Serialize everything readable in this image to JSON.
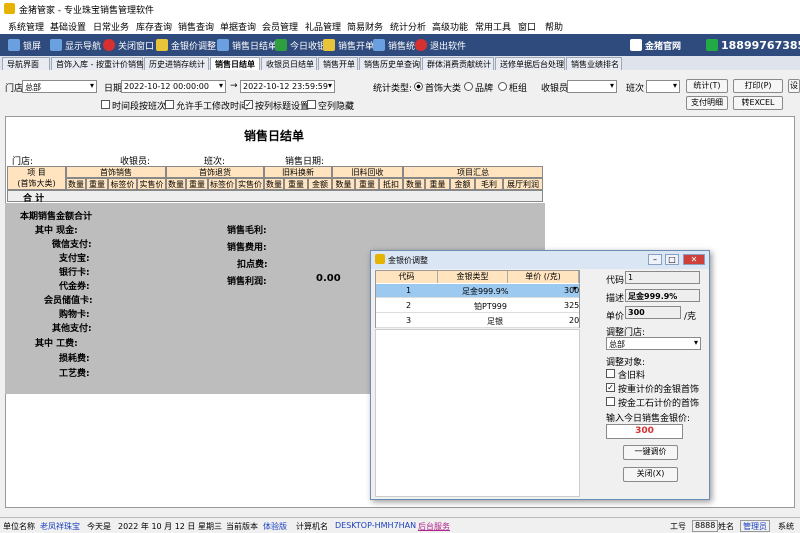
{
  "app": {
    "title": "金猪管家 - 专业珠宝销售管理软件"
  },
  "menu": [
    "系统管理",
    "基础设置",
    "日常业务",
    "库存查询",
    "销售查询",
    "单据查询",
    "会员管理",
    "礼品管理",
    "简易财务",
    "统计分析",
    "高级功能",
    "常用工具",
    "窗口",
    "帮助"
  ],
  "toolbar": {
    "items": [
      {
        "label": "锁屏",
        "icon": "lock-icon"
      },
      {
        "label": "显示导航",
        "icon": "navigation-icon"
      },
      {
        "label": "关闭窗口",
        "icon": "close-window-icon"
      },
      {
        "label": "金银价调整",
        "icon": "gold-price-icon"
      },
      {
        "label": "销售日结单",
        "icon": "daily-report-icon"
      },
      {
        "label": "今日收银",
        "icon": "cashier-icon"
      },
      {
        "label": "销售开单",
        "icon": "sales-order-icon"
      },
      {
        "label": "销售统计",
        "icon": "statistics-icon"
      },
      {
        "label": "退出软件",
        "icon": "exit-icon"
      }
    ],
    "website": "金猪官网",
    "phone": "18899767385"
  },
  "tabs": [
    "导航界面",
    "首饰入库 - 按重计价销售",
    "历史进销存统计",
    "销售日结单",
    "收银员日结单",
    "销售开单",
    "销售历史单查询",
    "群体消费贡献统计",
    "送修单据后台处理",
    "销售业绩排名"
  ],
  "active_tab": "销售日结单",
  "filters": {
    "store_label": "门店",
    "store_value": "总部",
    "date_label": "日期",
    "date_from": "2022-10-12 00:00:00",
    "date_to": "2022-10-12 23:59:59",
    "stat_type_label": "统计类型:",
    "stat_types": [
      "首饰大类",
      "品牌",
      "柜组"
    ],
    "cashier_label": "收银员",
    "shift_label": "班次",
    "options": [
      "时间段按班次",
      "允许手工修改时间",
      "按列标题设置",
      "空列隐藏"
    ],
    "buttons": {
      "stats": "统计(T)",
      "print": "打印(P)",
      "settings": "设",
      "payment_detail": "支付明细",
      "to_excel": "转EXCEL"
    }
  },
  "report": {
    "title": "销售日结单",
    "meta": [
      "门店:",
      "收银员:",
      "班次:",
      "销售日期:"
    ],
    "group_headers": [
      "项  目",
      "首饰销售",
      "首饰退货",
      "旧料换新",
      "旧料回收",
      "项目汇总"
    ],
    "item_sub": "(首饰大类)",
    "sub_headers": [
      "数量",
      "重量",
      "标签价",
      "实售价",
      "数量",
      "重量",
      "标签价",
      "实售价",
      "数量",
      "重量",
      "金额",
      "数量",
      "重量",
      "抵扣",
      "数量",
      "重量",
      "金额",
      "毛利",
      "展厅利润"
    ],
    "total_label": "合  计",
    "section_title": "本期销售金额合计",
    "left_labels": [
      "其中    现金:",
      "微信支付:",
      "支付宝:",
      "银行卡:",
      "代金券:",
      "会员储值卡:",
      "购物卡:",
      "其他支付:",
      "其中    工费:",
      "损耗费:",
      "工艺费:"
    ],
    "right_labels": [
      "销售毛利:",
      "销售费用:",
      "扣点费:",
      "销售利润:"
    ],
    "profit_value": "0.00"
  },
  "dialog": {
    "title": "金银价调整",
    "columns": [
      "代码",
      "金银类型",
      "单价 (/克)"
    ],
    "rows": [
      {
        "code": "1",
        "type": "足金999.9%",
        "price": "300"
      },
      {
        "code": "2",
        "type": "铂PT999",
        "price": "325"
      },
      {
        "code": "3",
        "type": "足银",
        "price": "20"
      }
    ],
    "code_label": "代码",
    "code_value": "1",
    "desc_label": "描述",
    "desc_value": "足金999.9%",
    "price_label": "单价",
    "price_value": "300",
    "price_unit": "/克",
    "store_label": "调整门店:",
    "store_value": "总部",
    "target_label": "调整对象:",
    "targets": [
      "含旧料",
      "按重计价的金银首饰",
      "按金工石计价的首饰"
    ],
    "today_label": "输入今日销售金银价:",
    "today_value": "300",
    "btn_adjust": "一键调价",
    "btn_close": "关闭(X)"
  },
  "status": {
    "unit_label": "单位名称",
    "unit_value": "老凤祥珠宝",
    "today_label": "今天是",
    "today_value": "2022 年 10 月 12 日  星期三",
    "version_label": "当前版本",
    "version_value": "体验版",
    "machine_label": "计算机名",
    "machine_value": "DESKTOP-HMH7HAN",
    "service": "后台服务",
    "worker_label": "工号",
    "worker_value": "8888",
    "user_label": "姓名",
    "user_value": "管理员",
    "role": "系统"
  },
  "colors": {
    "toolbar": "#2f4b7d",
    "header": "#ffe4bf",
    "selected_row": "#9cc9f0",
    "accent_red": "#d63030"
  }
}
